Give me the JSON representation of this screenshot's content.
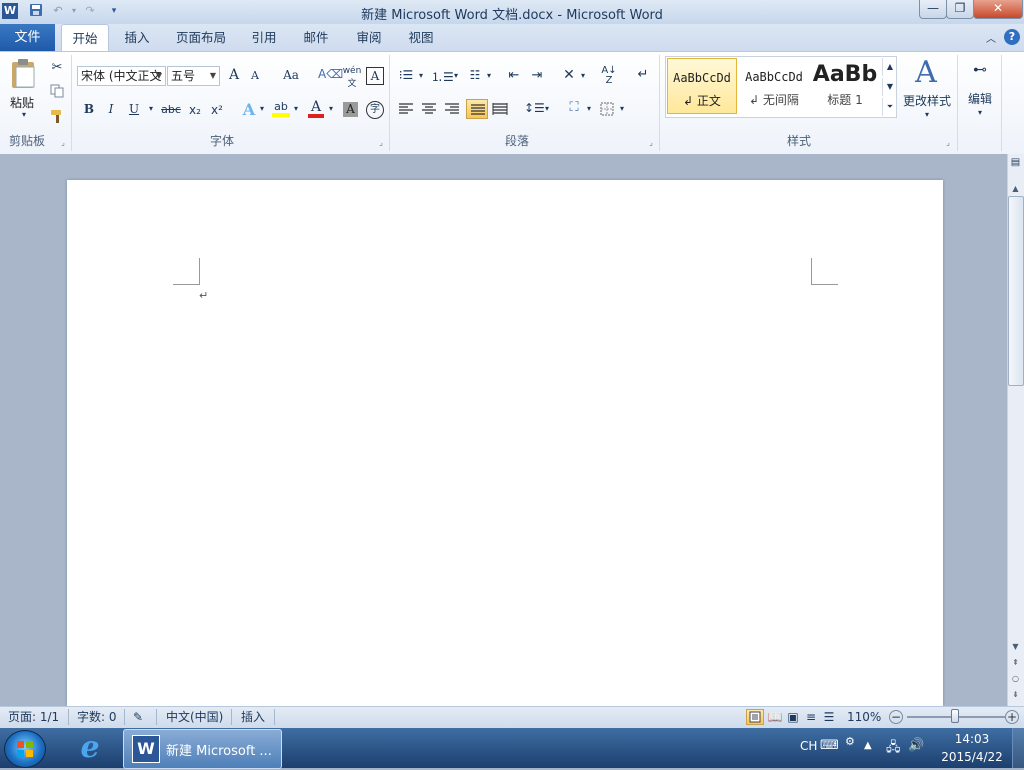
{
  "window": {
    "title": "新建 Microsoft Word 文档.docx - Microsoft Word",
    "app_icon": "W",
    "controls": {
      "minimize": "—",
      "restore": "❐",
      "close": "✕"
    }
  },
  "tabs": {
    "file": "文件",
    "items": [
      "开始",
      "插入",
      "页面布局",
      "引用",
      "邮件",
      "审阅",
      "视图"
    ],
    "active": "开始"
  },
  "ribbon": {
    "clipboard": {
      "label": "剪贴板",
      "paste": "粘贴"
    },
    "font": {
      "label": "字体",
      "font_name": "宋体 (中文正文",
      "font_size": "五号",
      "grow": "A",
      "shrink": "A",
      "change_case": "Aa",
      "bold": "B",
      "italic": "I",
      "underline": "U",
      "strike": "abc",
      "subscript": "x₂",
      "superscript": "x²",
      "effects": "A",
      "highlight": "ab",
      "font_color": "A",
      "char_shading": "A",
      "enclose": "字",
      "phonetic": "wén"
    },
    "paragraph": {
      "label": "段落"
    },
    "styles": {
      "label": "样式",
      "tiles": [
        {
          "preview": "AaBbCcDd",
          "name": "正文"
        },
        {
          "preview": "AaBbCcDd",
          "name": "无间隔"
        },
        {
          "preview": "AaBb",
          "name": "标题 1"
        }
      ],
      "change_styles": "更改样式"
    },
    "editing": {
      "label": "编辑"
    }
  },
  "document": {
    "paragraph_mark": "↵"
  },
  "statusbar": {
    "page": "页面: 1/1",
    "words": "字数: 0",
    "language": "中文(中国)",
    "mode": "插入",
    "zoom": "110%"
  },
  "taskbar": {
    "word_button": "新建 Microsoft ...",
    "ime": "CH",
    "time": "14:03",
    "date": "2015/4/22"
  },
  "colors": {
    "accent": "#2b5797",
    "file_tab": "#1f5aa8",
    "highlight": "#ffff00",
    "font_red": "#e02020"
  }
}
